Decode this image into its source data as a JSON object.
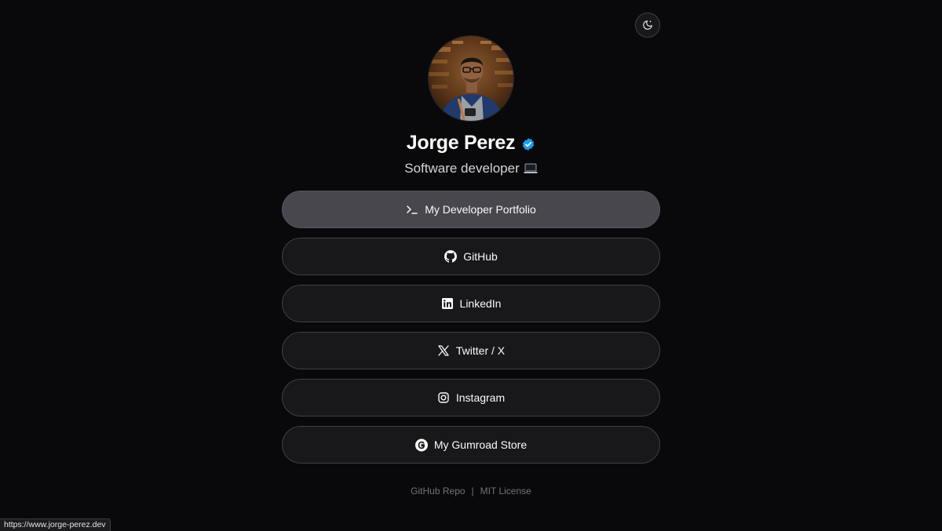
{
  "profile": {
    "name": "Jorge Perez",
    "bio": "Software developer",
    "bio_icon": "laptop-icon",
    "verified_color": "#1d9bf0"
  },
  "theme_toggle": {
    "icon": "moon-icon"
  },
  "links": [
    {
      "label": "My Developer Portfolio",
      "icon": "terminal-icon",
      "active": true
    },
    {
      "label": "GitHub",
      "icon": "github-icon",
      "active": false
    },
    {
      "label": "LinkedIn",
      "icon": "linkedin-icon",
      "active": false
    },
    {
      "label": "Twitter / X",
      "icon": "x-icon",
      "active": false
    },
    {
      "label": "Instagram",
      "icon": "instagram-icon",
      "active": false
    },
    {
      "label": "My Gumroad Store",
      "icon": "gumroad-icon",
      "active": false
    }
  ],
  "footer": {
    "repo_label": "GitHub Repo",
    "separator": "|",
    "license_label": "MIT License"
  },
  "status_bar": {
    "url": "https://www.jorge-perez.dev"
  },
  "colors": {
    "background": "#09090b",
    "button_bg": "#18181b",
    "button_active_bg": "#47474d",
    "border": "#3f3f46"
  }
}
